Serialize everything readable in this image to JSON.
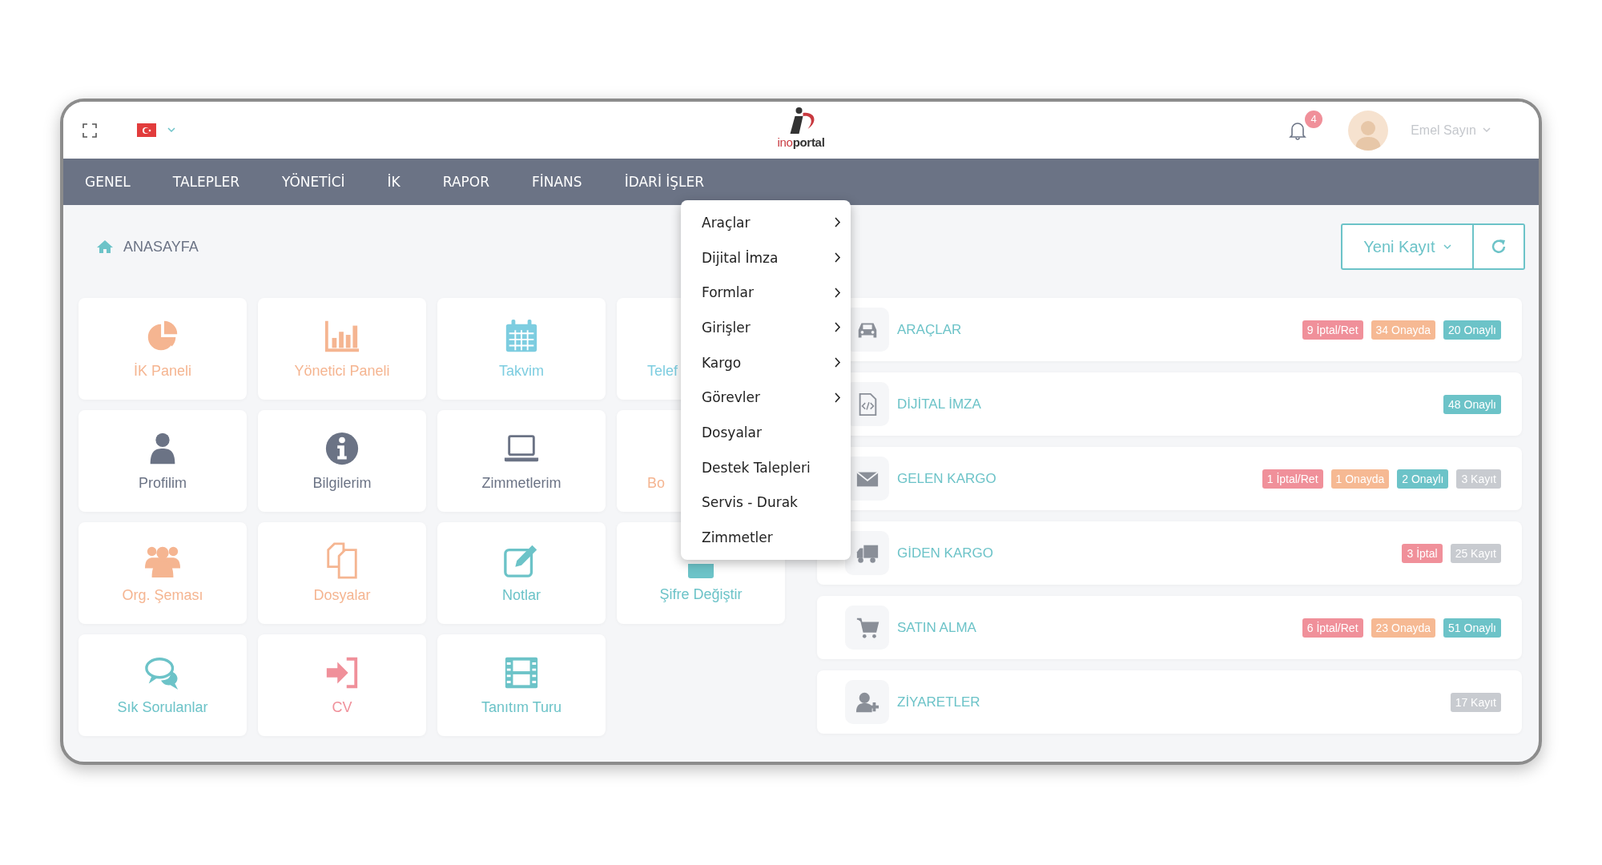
{
  "header": {
    "logo": {
      "prefix": "ino",
      "suffix": "portal"
    },
    "notifications": {
      "count": "4"
    },
    "user": {
      "name": "Emel Sayın"
    }
  },
  "nav": [
    {
      "label": "GENEL"
    },
    {
      "label": "TALEPLER"
    },
    {
      "label": "YÖNETİCİ"
    },
    {
      "label": "İK"
    },
    {
      "label": "RAPOR"
    },
    {
      "label": "FİNANS"
    },
    {
      "label": "İDARİ İŞLER"
    }
  ],
  "breadcrumb": {
    "label": "ANASAYFA"
  },
  "actions": {
    "new_record": "Yeni Kayıt"
  },
  "tiles": [
    {
      "label": "İK Paneli",
      "color": "#f5b591",
      "clipped": false
    },
    {
      "label": "Yönetici Paneli",
      "color": "#f5b591",
      "clipped": false
    },
    {
      "label": "Takvim",
      "color": "#7dcde0",
      "clipped": false
    },
    {
      "label": "Telef",
      "color": "#7dcde0",
      "clipped": true
    },
    {
      "label": "Profilim",
      "color": "#6b7385",
      "clipped": false
    },
    {
      "label": "Bilgilerim",
      "color": "#6b7385",
      "clipped": false
    },
    {
      "label": "Zimmetlerim",
      "color": "#6b7385",
      "clipped": false
    },
    {
      "label": "Bo",
      "color": "#f5b591",
      "clipped": true
    },
    {
      "label": "Org. Şeması",
      "color": "#f5b591",
      "clipped": false
    },
    {
      "label": "Dosyalar",
      "color": "#f5b591",
      "clipped": false
    },
    {
      "label": "Notlar",
      "color": "#6cc3c8",
      "clipped": false
    },
    {
      "label": "Şifre Değiştir",
      "color": "#6cc3c8",
      "clipped": false
    },
    {
      "label": "Sık Sorulanlar",
      "color": "#6cc3c8",
      "clipped": false
    },
    {
      "label": "CV",
      "color": "#f0909a",
      "clipped": false
    },
    {
      "label": "Tanıtım Turu",
      "color": "#6cc3c8",
      "clipped": false
    }
  ],
  "summary": [
    {
      "title": "ARAÇLAR",
      "badges": [
        {
          "label": "9 İptal/Ret",
          "kind": "rejected"
        },
        {
          "label": "34 Onayda",
          "kind": "pending"
        },
        {
          "label": "20 Onaylı",
          "kind": "approved"
        }
      ]
    },
    {
      "title": "DİJİTAL İMZA",
      "badges": [
        {
          "label": "48 Onaylı",
          "kind": "approved"
        }
      ]
    },
    {
      "title": "GELEN KARGO",
      "badges": [
        {
          "label": "1 İptal/Ret",
          "kind": "rejected"
        },
        {
          "label": "1 Onayda",
          "kind": "pending"
        },
        {
          "label": "2 Onaylı",
          "kind": "approved"
        },
        {
          "label": "3 Kayıt",
          "kind": "total"
        }
      ]
    },
    {
      "title": "GİDEN KARGO",
      "badges": [
        {
          "label": "3 İptal",
          "kind": "rejected"
        },
        {
          "label": "25 Kayıt",
          "kind": "total"
        }
      ]
    },
    {
      "title": "SATIN ALMA",
      "badges": [
        {
          "label": "6 İptal/Ret",
          "kind": "rejected"
        },
        {
          "label": "23 Onayda",
          "kind": "pending"
        },
        {
          "label": "51 Onaylı",
          "kind": "approved"
        }
      ]
    },
    {
      "title": "ZİYARETLER",
      "badges": [
        {
          "label": "17 Kayıt",
          "kind": "total"
        }
      ]
    }
  ],
  "dropdown": [
    {
      "label": "Araçlar",
      "has_submenu": true
    },
    {
      "label": "Dijital İmza",
      "has_submenu": true
    },
    {
      "label": "Formlar",
      "has_submenu": true
    },
    {
      "label": "Girişler",
      "has_submenu": true
    },
    {
      "label": "Kargo",
      "has_submenu": true
    },
    {
      "label": "Görevler",
      "has_submenu": true
    },
    {
      "label": "Dosyalar",
      "has_submenu": false
    },
    {
      "label": "Destek Talepleri",
      "has_submenu": false
    },
    {
      "label": "Servis - Durak",
      "has_submenu": false
    },
    {
      "label": "Zimmetler",
      "has_submenu": false
    }
  ]
}
